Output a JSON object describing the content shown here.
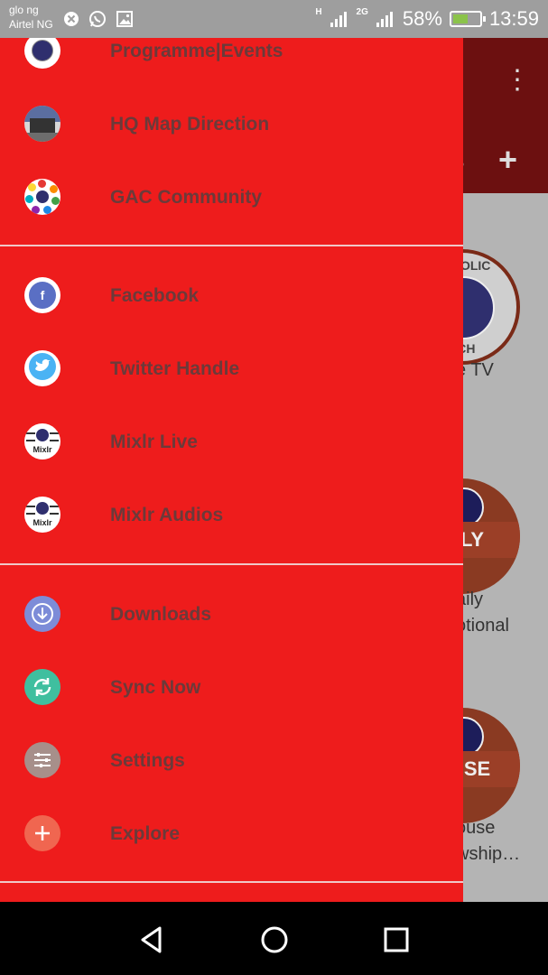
{
  "status_bar": {
    "carrier_line1": "glo ng",
    "carrier_line2": "Airtel NG",
    "net1": "H",
    "net2": "2G",
    "battery": "58%",
    "time": "13:59",
    "battery_level": 0.58,
    "icons": [
      "blocked-icon",
      "whatsapp-icon",
      "gallery-icon",
      "signal-icon",
      "battery-charging-icon"
    ]
  },
  "background_app": {
    "tab_fragment": "s",
    "cards": [
      {
        "label_lines": [
          "e TV"
        ],
        "badge": "APOSTOLIC",
        "badge2": "URCH"
      },
      {
        "label_lines": [
          "aily",
          "otional"
        ],
        "band": "AILY"
      },
      {
        "label_lines": [
          "ouse",
          "wship…"
        ],
        "band": "OUSE"
      }
    ]
  },
  "drawer": {
    "group1": [
      {
        "label": "Programme|Events",
        "icon": "church-logo-icon"
      },
      {
        "label": "HQ Map Direction",
        "icon": "map-photo-icon"
      },
      {
        "label": "GAC Community",
        "icon": "community-icon"
      }
    ],
    "group2": [
      {
        "label": "Facebook",
        "icon": "facebook-icon"
      },
      {
        "label": "Twitter Handle",
        "icon": "twitter-icon"
      },
      {
        "label": "Mixlr Live",
        "icon": "mixlr-icon"
      },
      {
        "label": "Mixlr Audios",
        "icon": "mixlr-icon"
      }
    ],
    "group3": [
      {
        "label": "Downloads",
        "icon": "download-icon"
      },
      {
        "label": "Sync Now",
        "icon": "sync-icon"
      },
      {
        "label": "Settings",
        "icon": "settings-sliders-icon"
      },
      {
        "label": "Explore",
        "icon": "add-icon"
      }
    ],
    "mixlr_text": "Mixlr"
  },
  "colors": {
    "drawer_bg": "#ee1c1c",
    "label_text": "#6b3a3a",
    "app_bar": "#6c1010"
  }
}
